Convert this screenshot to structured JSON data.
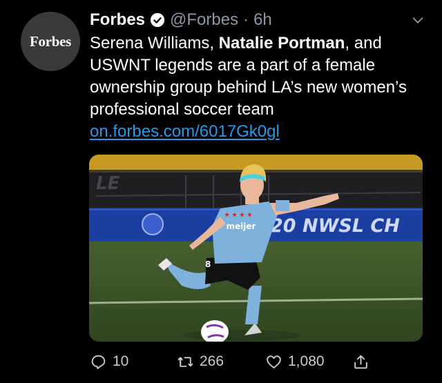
{
  "tweet": {
    "avatar_text": "Forbes",
    "display_name": "Forbes",
    "handle": "@Forbes",
    "separator": "·",
    "time": "6h",
    "text": {
      "part1": "Serena Williams, ",
      "bold": "Natalie Portman",
      "part2": ", and USWNT legends are a part of a  female ownership group behind LA’s new women’s professional soccer team"
    },
    "link": "on.forbes.com/6017Gk0gl",
    "image": {
      "banner_text": "20 NWSL CH",
      "jersey_text": "meijer",
      "jersey_number": "8"
    }
  },
  "actions": {
    "replies": "10",
    "retweets": "266",
    "likes": "1,080"
  },
  "colors": {
    "background": "#000000",
    "link": "#1d9bf0",
    "secondary_text": "#8b98a5",
    "jersey_blue": "#7eb1dc"
  },
  "icons": [
    "verified-badge-icon",
    "chevron-down-icon",
    "reply-icon",
    "retweet-icon",
    "like-icon",
    "share-icon"
  ]
}
